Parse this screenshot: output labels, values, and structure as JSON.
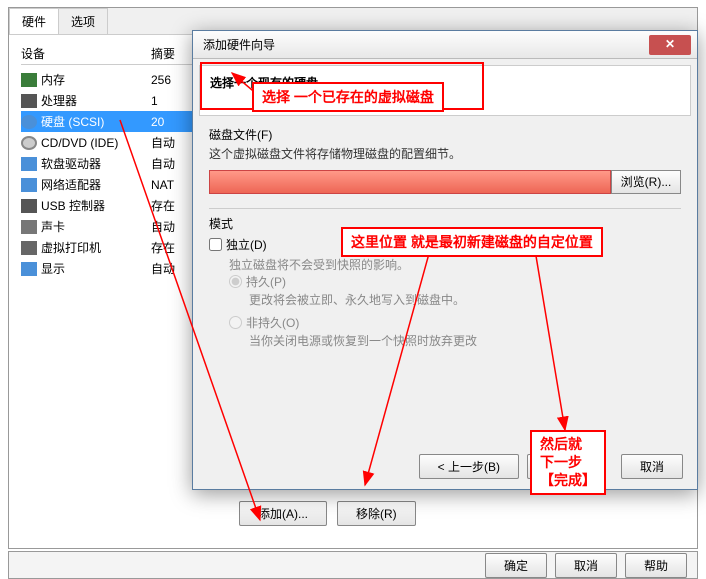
{
  "tabs": {
    "hardware": "硬件",
    "options": "选项"
  },
  "table": {
    "head_device": "设备",
    "head_summary": "摘要"
  },
  "devices": [
    {
      "icon": "icon-mem",
      "name": "内存",
      "val": "256"
    },
    {
      "icon": "icon-cpu",
      "name": "处理器",
      "val": "1"
    },
    {
      "icon": "icon-disk",
      "name": "硬盘 (SCSI)",
      "val": "20",
      "selected": true
    },
    {
      "icon": "icon-cd",
      "name": "CD/DVD (IDE)",
      "val": "自动"
    },
    {
      "icon": "icon-floppy",
      "name": "软盘驱动器",
      "val": "自动"
    },
    {
      "icon": "icon-net",
      "name": "网络适配器",
      "val": "NAT"
    },
    {
      "icon": "icon-usb",
      "name": "USB 控制器",
      "val": "存在"
    },
    {
      "icon": "icon-sound",
      "name": "声卡",
      "val": "自动"
    },
    {
      "icon": "icon-print",
      "name": "虚拟打印机",
      "val": "存在"
    },
    {
      "icon": "icon-display",
      "name": "显示",
      "val": "自动"
    }
  ],
  "btns": {
    "add": "添加(A)...",
    "remove": "移除(R)"
  },
  "wizard": {
    "title": "添加硬件向导",
    "head": "选择一个现有的硬盘",
    "disk_file": "磁盘文件(F)",
    "disk_desc": "这个虚拟磁盘文件将存储物理磁盘的配置细节。",
    "browse": "浏览(R)...",
    "mode": "模式",
    "independent": "独立(D)",
    "independent_desc": "独立磁盘将不会受到快照的影响。",
    "persistent": "持久(P)",
    "persistent_desc": "更改将会被立即、永久地写入到磁盘中。",
    "nonpersistent": "非持久(O)",
    "nonpersistent_desc": "当你关闭电源或恢复到一个快照时放弃更改",
    "back": "< 上一步(B)",
    "next": "下一步",
    "cancel": "取消"
  },
  "bottom": {
    "ok": "确定",
    "cancel": "取消",
    "help": "帮助"
  },
  "annot": {
    "a1": "选择    一个已存在的虚拟磁盘",
    "a2": "这里位置  就是最初新建磁盘的自定位置",
    "a3": "然后就\n下一步\n【完成】"
  }
}
